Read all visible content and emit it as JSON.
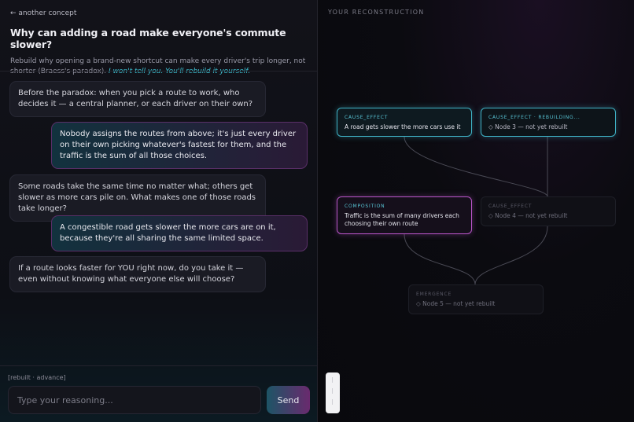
{
  "header": {
    "back_link": "← another concept",
    "title": "Why can adding a road make everyone's commute slower?",
    "subtitle": "Rebuild why opening a brand-new shortcut can make every driver's trip longer, not shorter (Braess's paradox).",
    "subtitle_emphasis": "I won't tell you. You'll rebuild it yourself."
  },
  "messages": [
    {
      "role": "ai",
      "text": "Before the paradox: when you pick a route to work, who decides it — a central planner, or each driver on their own?"
    },
    {
      "role": "user",
      "text": "Nobody assigns the routes from above; it's just every driver on their own picking whatever's fastest for them, and the traffic is the sum of all those choices."
    },
    {
      "role": "ai",
      "text": "Some roads take the same time no matter what; others get slower as more cars pile on. What makes one of those roads take longer?"
    },
    {
      "role": "user",
      "text": "A congestible road gets slower the more cars are on it, because they're all sharing the same limited space."
    },
    {
      "role": "ai",
      "text": "If a route looks faster for YOU right now, do you take it — even without knowing what everyone else will choose?"
    }
  ],
  "composer": {
    "mode_label": "[rebuilt · advance]",
    "placeholder": "Type your reasoning...",
    "send_label": "Send"
  },
  "reconstruction": {
    "panel_title": "YOUR RECONSTRUCTION",
    "nodes": [
      {
        "id": "n1",
        "tag": "CAUSE_EFFECT",
        "text": "A road gets slower the more cars use it",
        "status": "built"
      },
      {
        "id": "n3",
        "tag": "CAUSE_EFFECT · REBUILDING...",
        "text": "◇ Node 3 — not yet rebuilt",
        "status": "rebuilding"
      },
      {
        "id": "n2",
        "tag": "COMPOSITION",
        "text": "Traffic is the sum of many drivers each choosing their own route",
        "status": "built"
      },
      {
        "id": "n4",
        "tag": "CAUSE_EFFECT",
        "text": "◇ Node 4 — not yet rebuilt",
        "status": "pending"
      },
      {
        "id": "n5",
        "tag": "EMERGENCE",
        "text": "◇ Node 5 — not yet rebuilt",
        "status": "pending"
      }
    ]
  },
  "colors": {
    "accent_teal": "#3fb2c6",
    "accent_pink": "#b955c9",
    "background": "#0b0b10"
  }
}
